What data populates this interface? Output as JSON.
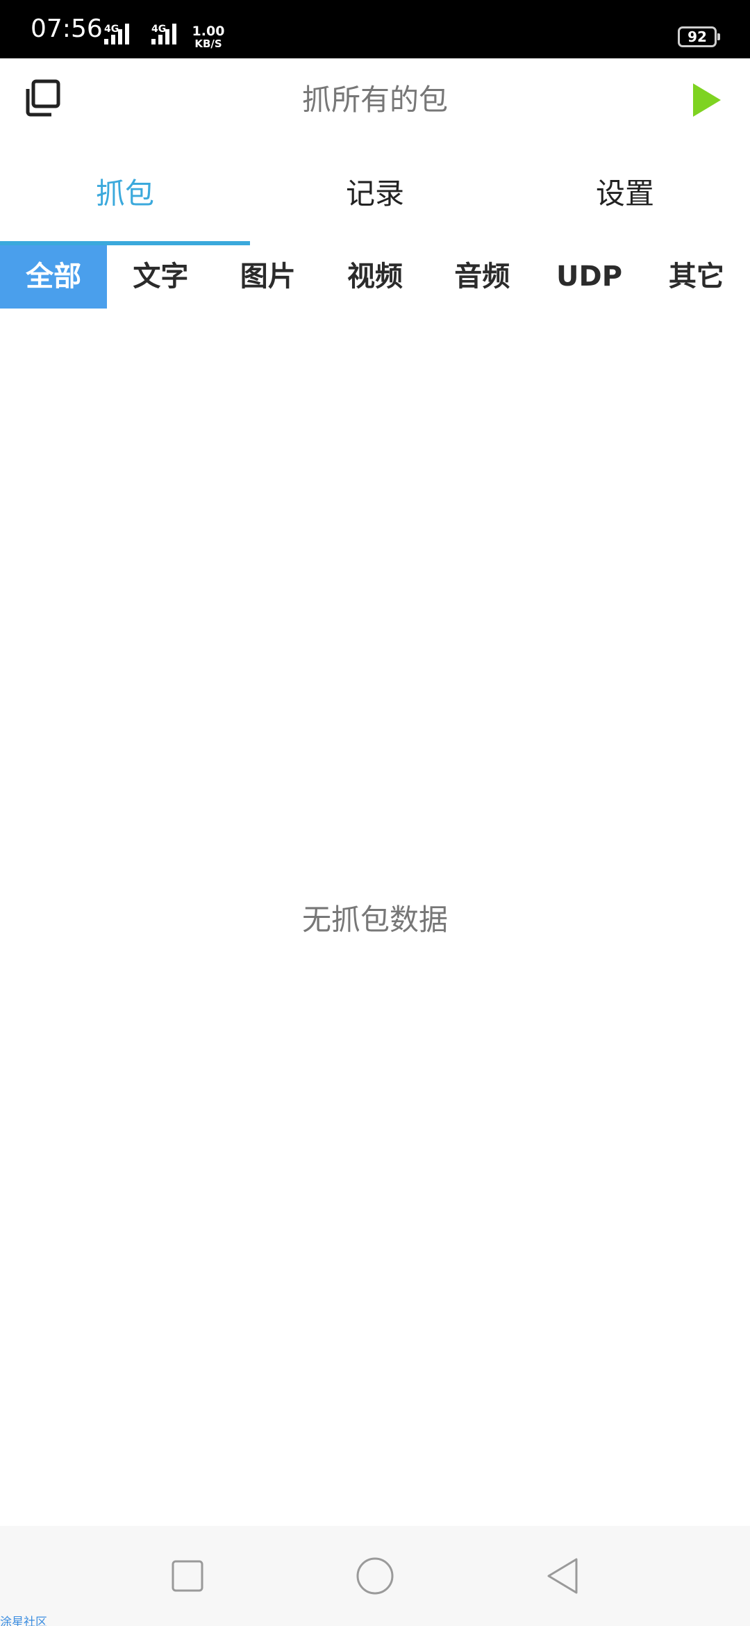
{
  "status_bar": {
    "time": "07:56",
    "signal1_label": "4G",
    "signal2_label": "4G",
    "net_speed_value": "1.00",
    "net_speed_unit": "KB/S",
    "battery": "92"
  },
  "toolbar": {
    "title": "抓所有的包",
    "copy_icon": "copy-icon",
    "play_icon": "play-icon",
    "play_color": "#7ed321"
  },
  "main_tabs": [
    {
      "label": "抓包",
      "active": true
    },
    {
      "label": "记录",
      "active": false
    },
    {
      "label": "设置",
      "active": false
    }
  ],
  "filters": [
    {
      "label": "全部",
      "active": true
    },
    {
      "label": "文字",
      "active": false
    },
    {
      "label": "图片",
      "active": false
    },
    {
      "label": "视频",
      "active": false
    },
    {
      "label": "音频",
      "active": false
    },
    {
      "label": "UDP",
      "active": false
    },
    {
      "label": "其它",
      "active": false
    }
  ],
  "empty_state": "无抓包数据",
  "nav_bar": {
    "recents_icon": "square-icon",
    "home_icon": "circle-icon",
    "back_icon": "triangle-back-icon"
  },
  "watermark": "涂星社区",
  "colors": {
    "accent": "#3ba9dc",
    "chip_active": "#4a9fec"
  }
}
